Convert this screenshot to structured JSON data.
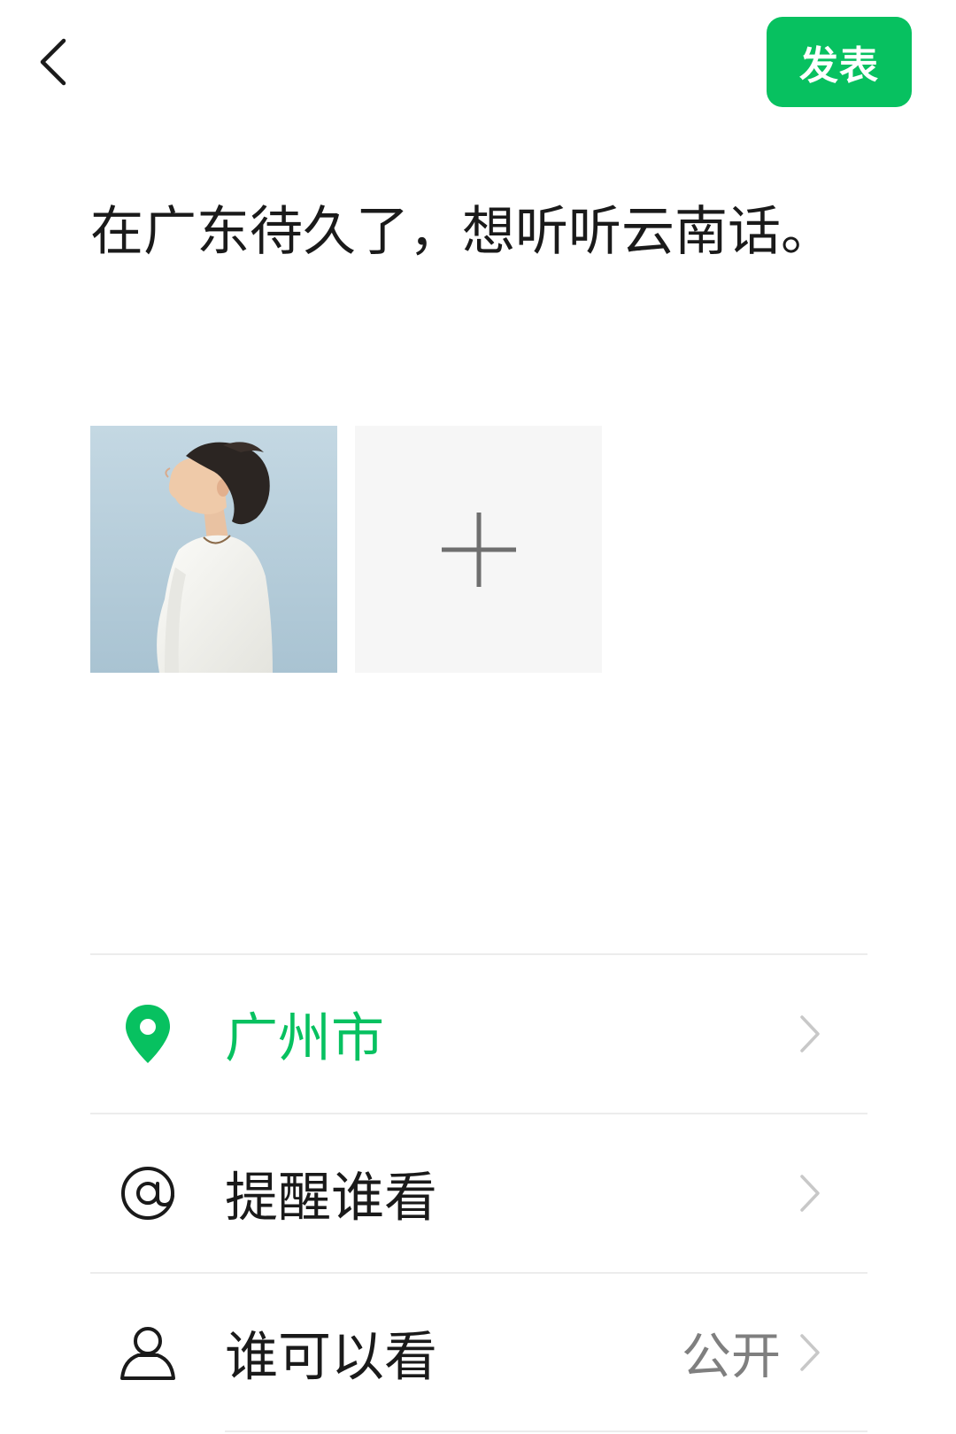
{
  "header": {
    "back_icon": "chevron-left-icon",
    "publish_label": "发表"
  },
  "post": {
    "text": "在广东待久了，想听听云南话。"
  },
  "photos": {
    "items": [
      {
        "alt": "photo"
      }
    ],
    "add_icon": "plus-icon"
  },
  "settings": {
    "location": {
      "icon": "location-pin-icon",
      "label": "广州市"
    },
    "mention": {
      "icon": "at-icon",
      "label": "提醒谁看"
    },
    "visibility": {
      "icon": "person-icon",
      "label": "谁可以看",
      "value": "公开"
    }
  },
  "colors": {
    "accent": "#07c160",
    "text": "#1a1a1a",
    "secondary_text": "#7f7f7f",
    "divider": "#ececec",
    "add_tile_bg": "#f6f6f6"
  }
}
